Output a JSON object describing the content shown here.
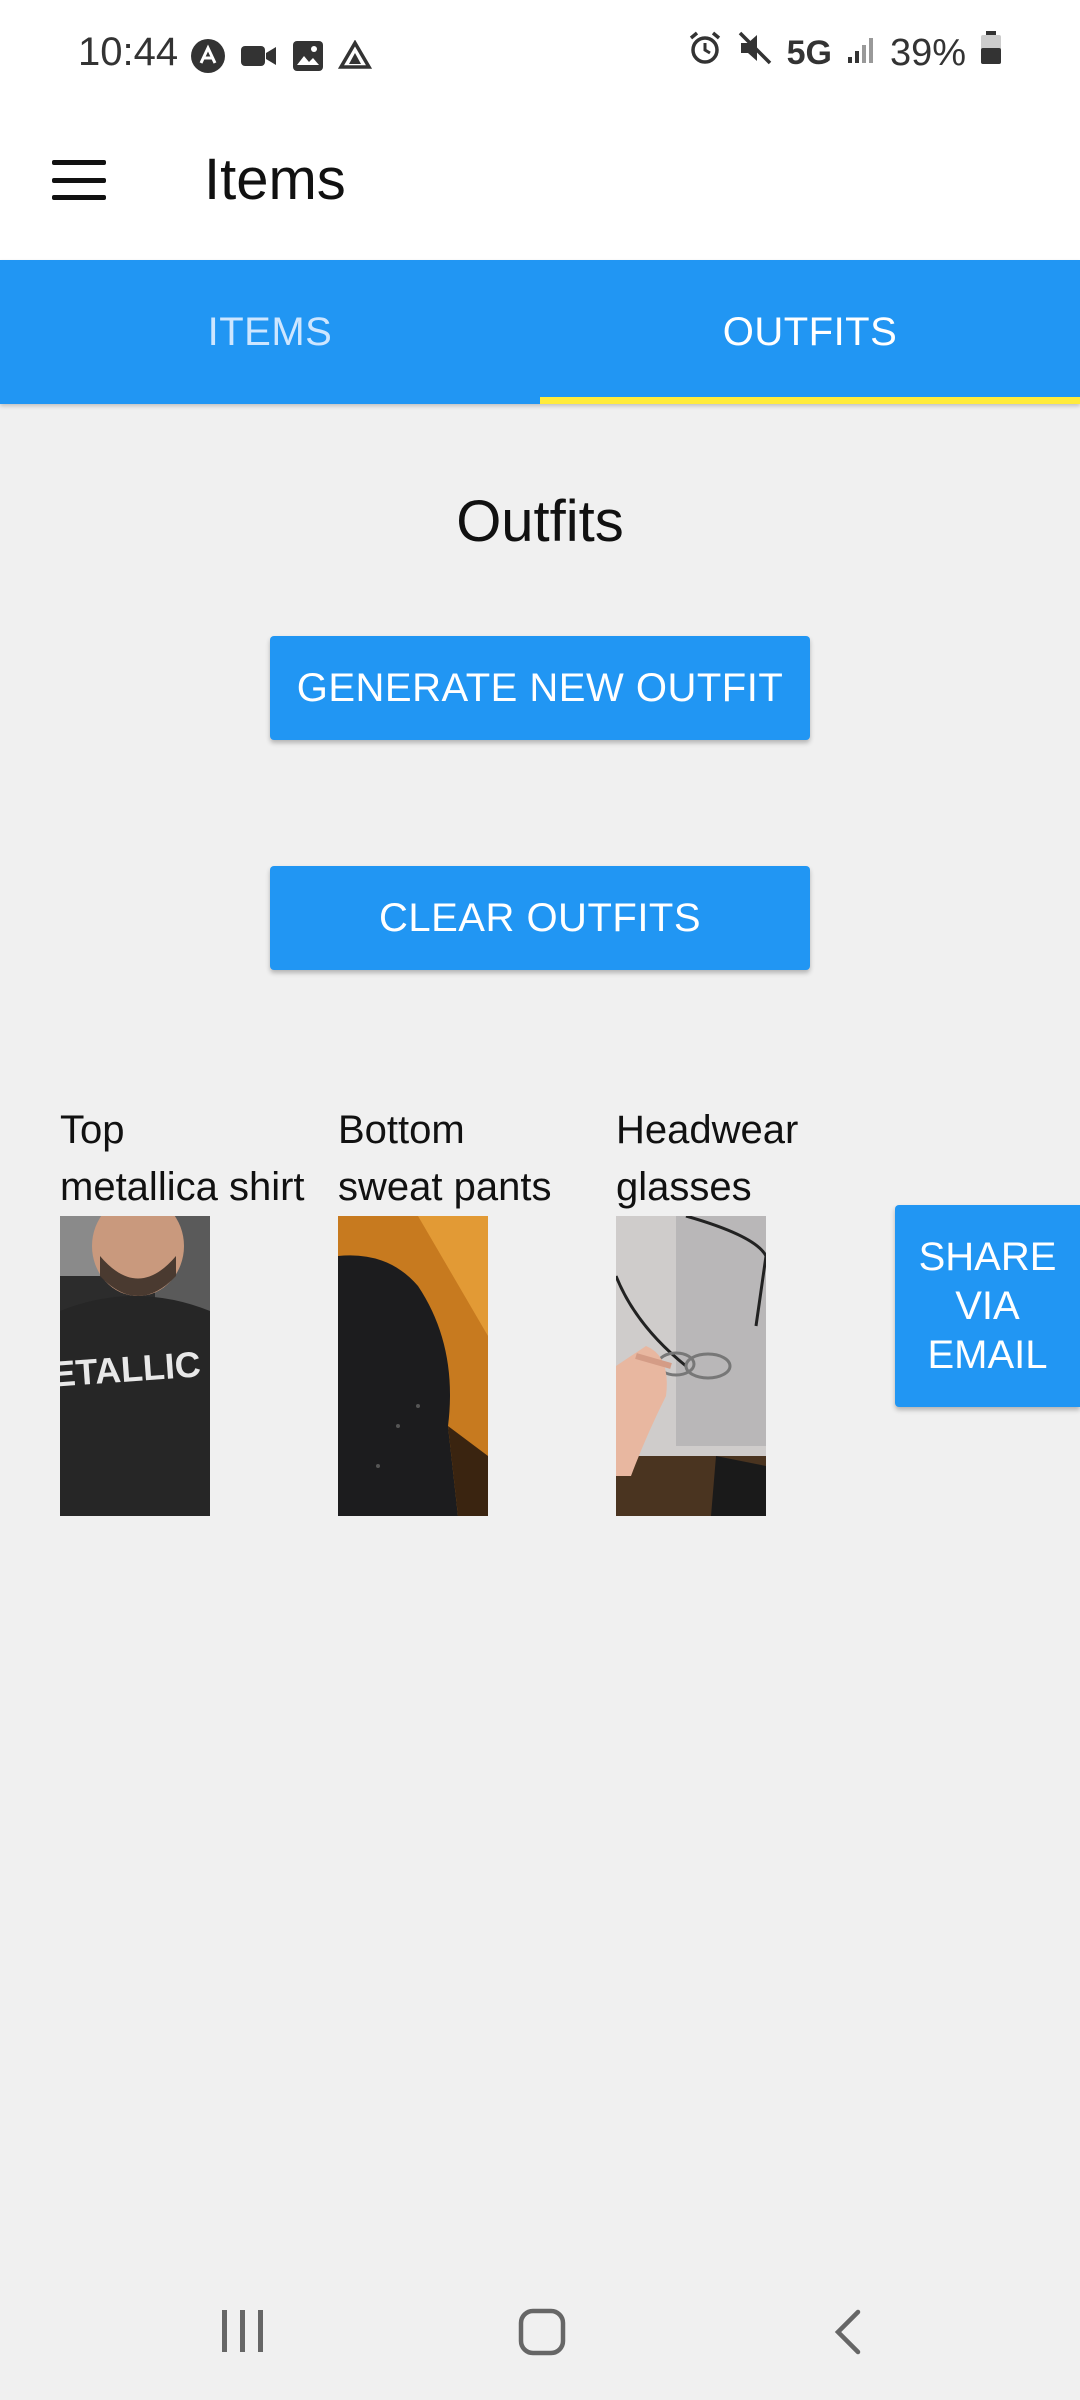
{
  "status_bar": {
    "time": "10:44",
    "network": "5G",
    "battery": "39%",
    "left_icons": [
      "app-icon",
      "video-icon",
      "image-icon",
      "drive-icon"
    ],
    "right_icons": [
      "alarm-icon",
      "mute-icon",
      "signal-icon",
      "battery-icon"
    ]
  },
  "app_bar": {
    "title": "Items",
    "menu_icon": "hamburger-menu-icon"
  },
  "tabs": [
    {
      "label": "ITEMS",
      "active": false
    },
    {
      "label": "OUTFITS",
      "active": true
    }
  ],
  "main": {
    "title": "Outfits",
    "generate_label": "GENERATE NEW OUTFIT",
    "clear_label": "CLEAR OUTFITS",
    "share_label_lines": [
      "SHARE",
      "VIA",
      "EMAIL"
    ],
    "outfit": [
      {
        "category": "Top",
        "name": "metallica shirt",
        "thumb": "shirt-photo"
      },
      {
        "category": "Bottom",
        "name": "sweat pants",
        "thumb": "pants-photo"
      },
      {
        "category": "Headwear",
        "name": "glasses",
        "thumb": "glasses-photo"
      }
    ]
  },
  "colors": {
    "accent": "#2196f3",
    "tab_indicator": "#ffeb3b",
    "background": "#f0f0f0"
  },
  "nav_bar": {
    "icons": [
      "recents-icon",
      "home-icon",
      "back-icon"
    ]
  }
}
